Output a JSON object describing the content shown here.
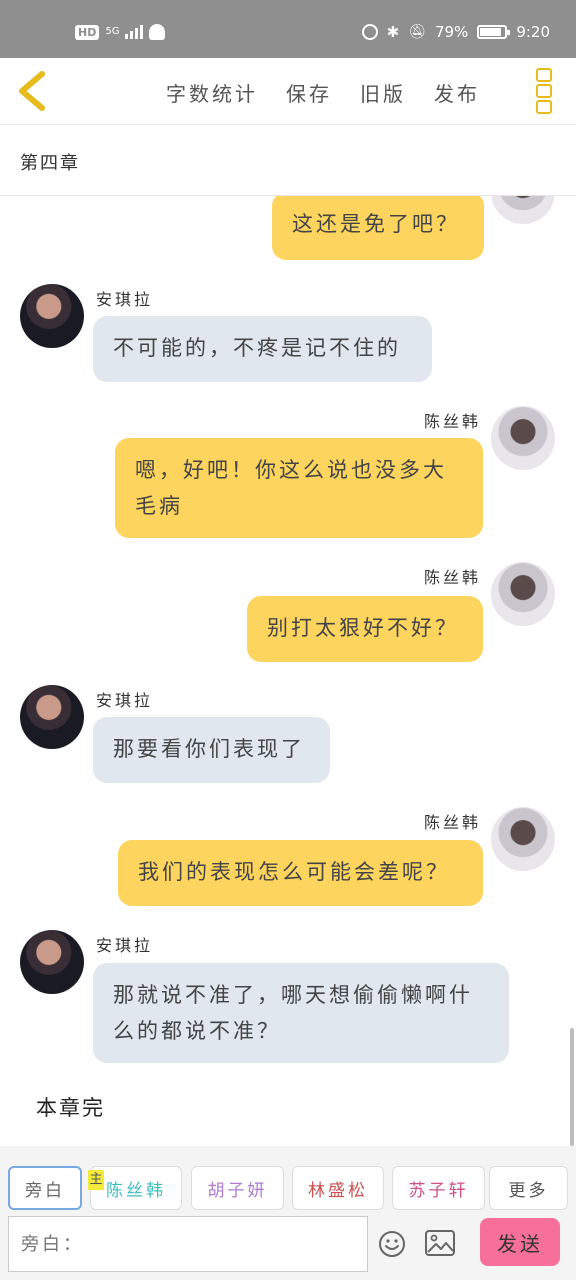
{
  "status_bar": {
    "hd": "HD",
    "network": "5G",
    "battery": "79%",
    "time": "9:20"
  },
  "toolbar": {
    "actions": [
      "字数统计",
      "保存",
      "旧版",
      "发布"
    ]
  },
  "chapter": {
    "title": "第四章"
  },
  "messages": [
    {
      "side": "right",
      "speaker": "",
      "text": "这还是免了吧？"
    },
    {
      "side": "left",
      "speaker": "安琪拉",
      "text": "不可能的，不疼是记不住的"
    },
    {
      "side": "right",
      "speaker": "陈丝韩",
      "text": "嗯，好吧！你这么说也没多大毛病"
    },
    {
      "side": "right",
      "speaker": "陈丝韩",
      "text": "别打太狠好不好？"
    },
    {
      "side": "left",
      "speaker": "安琪拉",
      "text": "那要看你们表现了"
    },
    {
      "side": "right",
      "speaker": "陈丝韩",
      "text": "我们的表现怎么可能会差呢？"
    },
    {
      "side": "left",
      "speaker": "安琪拉",
      "text": "那就说不准了，哪天想偷偷懒啊什么的都说不准？"
    }
  ],
  "end_text": "本章完",
  "characters": {
    "narration": "旁白",
    "main_badge": "主",
    "list": [
      {
        "name": "陈丝韩",
        "color": "#3fbfbf"
      },
      {
        "name": "胡子妍",
        "color": "#b07ad0"
      },
      {
        "name": "林盛松",
        "color": "#d05050"
      },
      {
        "name": "苏子轩",
        "color": "#d0508a"
      }
    ],
    "more": "更多"
  },
  "input": {
    "placeholder": "旁白："
  },
  "send_label": "发送",
  "colors": {
    "accent": "#e6bb1e",
    "bubble_self": "#fdd55e",
    "bubble_other": "#e1e7ef",
    "send_button": "#f7709a"
  }
}
